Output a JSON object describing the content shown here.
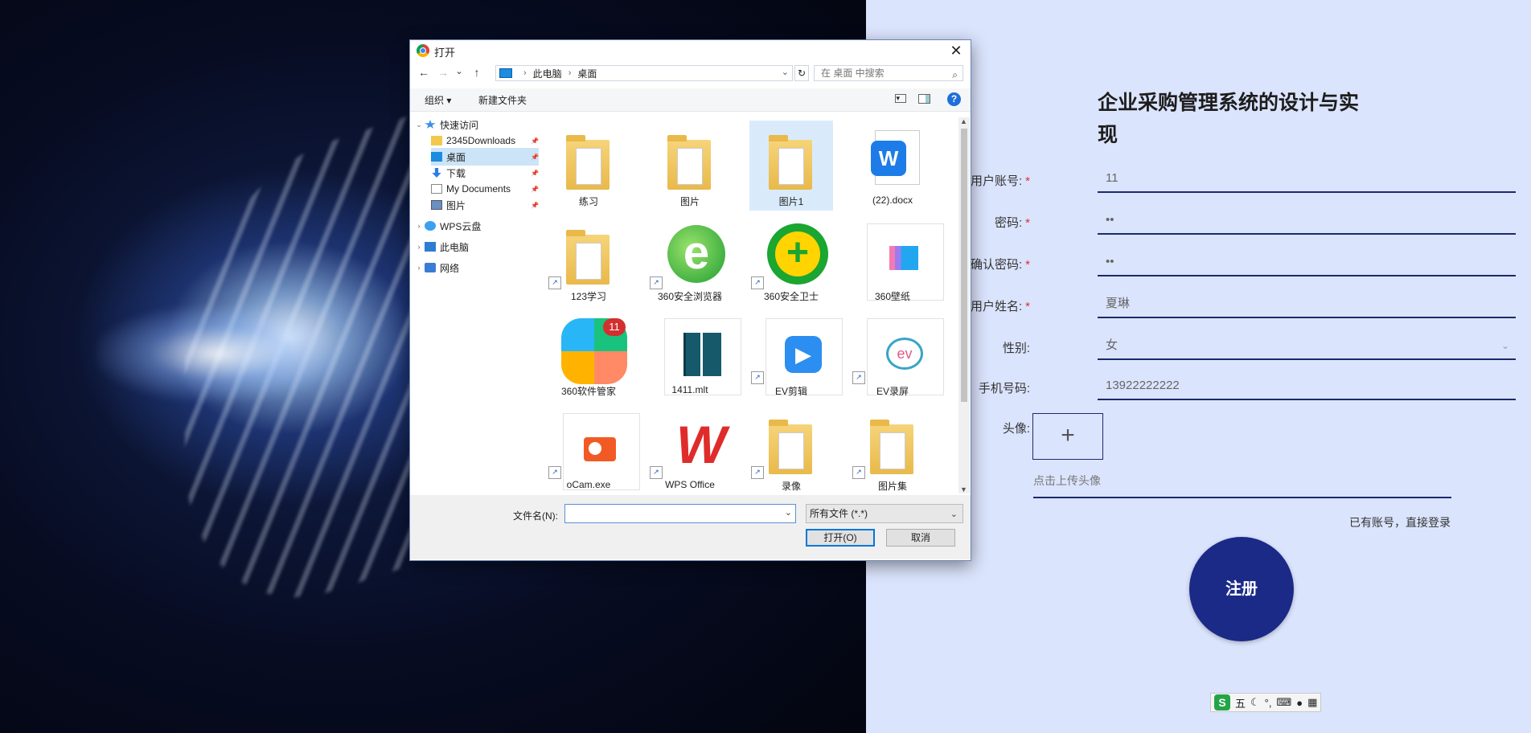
{
  "register": {
    "title": "企业采购管理系统的设计与实现",
    "fields": [
      {
        "label": "用户账号:",
        "required": true,
        "value": "11"
      },
      {
        "label": "密码:",
        "required": true,
        "value": "••"
      },
      {
        "label": "确认密码:",
        "required": true,
        "value": "••"
      },
      {
        "label": "用户姓名:",
        "required": true,
        "value": "夏琳"
      },
      {
        "label": "性别:",
        "required": false,
        "value": "女"
      },
      {
        "label": "手机号码:",
        "required": false,
        "value": "13922222222"
      }
    ],
    "avatar_label": "头像:",
    "avatar_plus": "+",
    "avatar_hint": "点击上传头像",
    "login_link": "已有账号，直接登录",
    "submit": "注册",
    "required_mark": "*"
  },
  "ime": {
    "logo": "S",
    "mode": "五",
    "icons": [
      "moon-icon",
      "punct-icon",
      "keyboard-icon",
      "user-icon",
      "grid-icon"
    ]
  },
  "dialog": {
    "title": "打开",
    "close": "✕",
    "nav": {
      "back": "←",
      "forward": "→",
      "recent": "⌄",
      "up": "↑"
    },
    "breadcrumb": [
      "此电脑",
      "桌面"
    ],
    "search_placeholder": "在 桌面 中搜索",
    "toolbar": {
      "organize": "组织 ▾",
      "new_folder": "新建文件夹",
      "help": "?"
    },
    "sidebar": [
      {
        "label": "快速访问",
        "icon": "star-icon",
        "level": 0,
        "expander": "⌄",
        "pinned": false,
        "selected": false
      },
      {
        "label": "2345Downloads",
        "icon": "folder-icon",
        "level": 1,
        "expander": "",
        "pinned": true,
        "selected": false
      },
      {
        "label": "桌面",
        "icon": "desktop-icon",
        "level": 1,
        "expander": "",
        "pinned": true,
        "selected": true
      },
      {
        "label": "下载",
        "icon": "download-icon",
        "level": 1,
        "expander": "",
        "pinned": true,
        "selected": false
      },
      {
        "label": "My Documents",
        "icon": "document-icon",
        "level": 1,
        "expander": "",
        "pinned": true,
        "selected": false
      },
      {
        "label": "图片",
        "icon": "picture-icon",
        "level": 1,
        "expander": "",
        "pinned": true,
        "selected": false
      },
      {
        "label": "WPS云盘",
        "icon": "cloud-icon",
        "level": 0,
        "expander": "›",
        "pinned": false,
        "selected": false
      },
      {
        "label": "此电脑",
        "icon": "computer-icon",
        "level": 0,
        "expander": "›",
        "pinned": false,
        "selected": false
      },
      {
        "label": "网络",
        "icon": "network-icon",
        "level": 0,
        "expander": "›",
        "pinned": false,
        "selected": false
      }
    ],
    "files": [
      {
        "name": "练习",
        "kind": "folder",
        "shortcut": false,
        "selected": false
      },
      {
        "name": "图片",
        "kind": "folder",
        "shortcut": false,
        "selected": false
      },
      {
        "name": "图片1",
        "kind": "folder",
        "shortcut": false,
        "selected": true
      },
      {
        "name": "(22).docx",
        "kind": "wps-doc",
        "shortcut": false,
        "selected": false
      },
      {
        "name": "123学习",
        "kind": "folder",
        "shortcut": true,
        "selected": false
      },
      {
        "name": "360安全浏览器",
        "kind": "ie-browser",
        "shortcut": true,
        "selected": false
      },
      {
        "name": "360安全卫士",
        "kind": "security",
        "shortcut": true,
        "selected": false
      },
      {
        "name": "360壁纸",
        "kind": "wallpaper",
        "shortcut": false,
        "selected": false
      },
      {
        "name": "360软件管家",
        "kind": "softmgr",
        "shortcut": false,
        "selected": false,
        "badge": "11"
      },
      {
        "name": "1411.mlt",
        "kind": "mlt",
        "shortcut": false,
        "selected": false
      },
      {
        "name": "EV剪辑",
        "kind": "ev-clip",
        "shortcut": true,
        "selected": false
      },
      {
        "name": "EV录屏",
        "kind": "ev-record",
        "shortcut": true,
        "selected": false
      },
      {
        "name": "oCam.exe",
        "kind": "ocam",
        "shortcut": true,
        "selected": false
      },
      {
        "name": "WPS Office",
        "kind": "wps",
        "shortcut": true,
        "selected": false
      },
      {
        "name": "录像",
        "kind": "folder",
        "shortcut": true,
        "selected": false
      },
      {
        "name": "图片集",
        "kind": "folder",
        "shortcut": true,
        "selected": false
      }
    ],
    "filename_label": "文件名(N):",
    "filename_value": "",
    "filetype": "所有文件 (*.*)",
    "open_button": "打开(O)",
    "cancel_button": "取消"
  },
  "colors": {
    "accent": "#1b2a87",
    "panel": "#dbe4fd",
    "required": "#e0302f",
    "selection": "#cce4f7"
  }
}
